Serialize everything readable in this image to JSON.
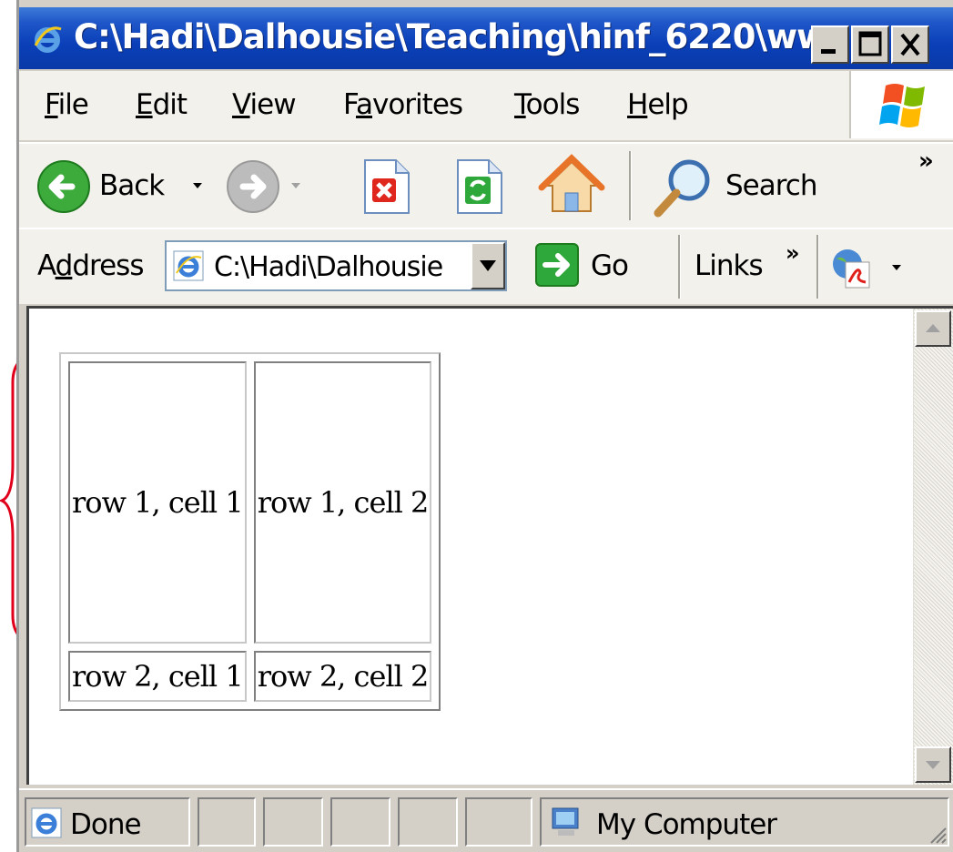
{
  "window": {
    "title": "C:\\Hadi\\Dalhousie\\Teaching\\hinf_6220\\ww...",
    "controls": [
      "minimize",
      "maximize",
      "close"
    ]
  },
  "menu": {
    "items": [
      {
        "label": "File",
        "underline": "F",
        "rest": "ile"
      },
      {
        "label": "Edit",
        "underline": "E",
        "rest": "dit"
      },
      {
        "label": "View",
        "underline": "V",
        "rest": "iew"
      },
      {
        "label": "Favorites",
        "pre": "F",
        "underline": "a",
        "rest": "vorites"
      },
      {
        "label": "Tools",
        "underline": "T",
        "rest": "ools"
      },
      {
        "label": "Help",
        "underline": "H",
        "rest": "elp"
      }
    ]
  },
  "toolbar": {
    "back_label": "Back",
    "search_label": "Search",
    "overflow": "»"
  },
  "address": {
    "label_pre": "A",
    "label_u": "d",
    "label_post": "dress",
    "value": "C:\\Hadi\\Dalhousie",
    "go_label": "Go",
    "links_label": "Links",
    "links_overflow": "»"
  },
  "page": {
    "table": [
      [
        "row 1, cell 1",
        "row 1, cell 2"
      ],
      [
        "row 2, cell 1",
        "row 2, cell 2"
      ]
    ]
  },
  "status": {
    "text": "Done",
    "zone": "My Computer"
  },
  "colors": {
    "titlebar": "#0a3fb8",
    "chrome": "#d4d0c8",
    "toolbar_bg": "#f2f1eb",
    "annotation_brace": "#e0001b"
  }
}
